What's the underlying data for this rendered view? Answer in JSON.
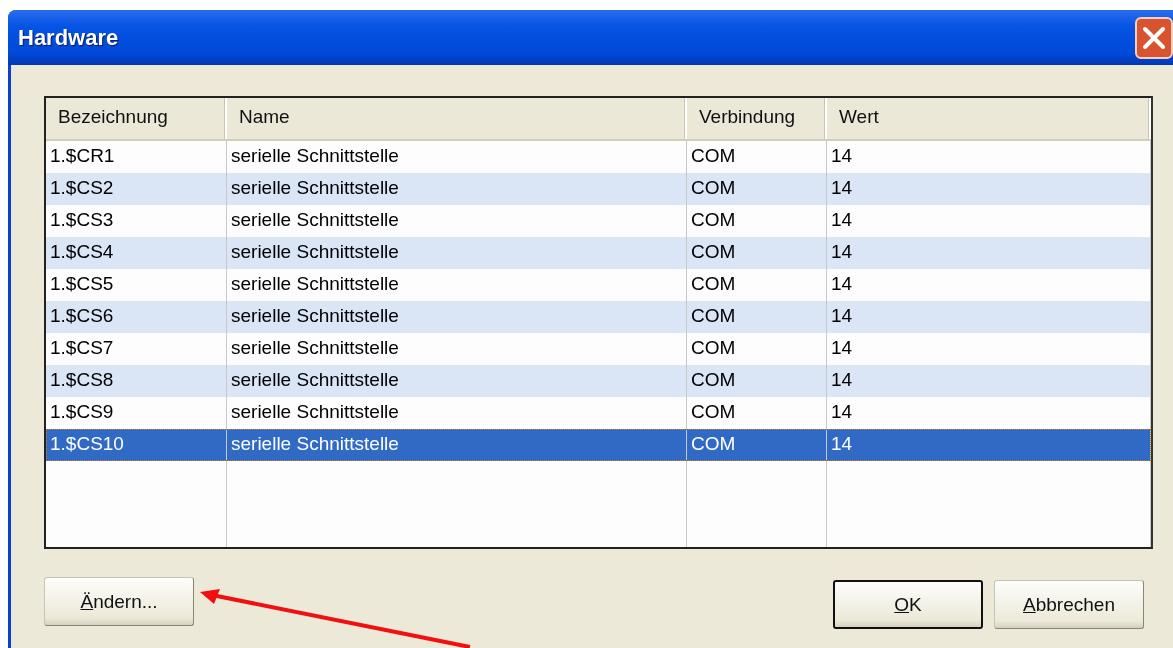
{
  "window": {
    "title": "Hardware"
  },
  "table": {
    "columns": [
      "Bezeichnung",
      "Name",
      "Verbindung",
      "Wert"
    ],
    "rows": [
      {
        "cells": [
          "1.$CR1",
          "serielle Schnittstelle",
          "COM",
          "14"
        ],
        "selected": false
      },
      {
        "cells": [
          "1.$CS2",
          "serielle Schnittstelle",
          "COM",
          "14"
        ],
        "selected": false
      },
      {
        "cells": [
          "1.$CS3",
          "serielle Schnittstelle",
          "COM",
          "14"
        ],
        "selected": false
      },
      {
        "cells": [
          "1.$CS4",
          "serielle Schnittstelle",
          "COM",
          "14"
        ],
        "selected": false
      },
      {
        "cells": [
          "1.$CS5",
          "serielle Schnittstelle",
          "COM",
          "14"
        ],
        "selected": false
      },
      {
        "cells": [
          "1.$CS6",
          "serielle Schnittstelle",
          "COM",
          "14"
        ],
        "selected": false
      },
      {
        "cells": [
          "1.$CS7",
          "serielle Schnittstelle",
          "COM",
          "14"
        ],
        "selected": false
      },
      {
        "cells": [
          "1.$CS8",
          "serielle Schnittstelle",
          "COM",
          "14"
        ],
        "selected": false
      },
      {
        "cells": [
          "1.$CS9",
          "serielle Schnittstelle",
          "COM",
          "14"
        ],
        "selected": false
      },
      {
        "cells": [
          "1.$CS10",
          "serielle Schnittstelle",
          "COM",
          "14"
        ],
        "selected": true
      }
    ]
  },
  "buttons": [
    {
      "label": "Ändern...",
      "kind": "left",
      "default": false,
      "access_key_underlined": true
    },
    {
      "label": "OK",
      "kind": "right",
      "default": true,
      "access_key_underlined": true
    },
    {
      "label": "Abbrechen",
      "kind": "right",
      "default": false,
      "access_key_underlined": true
    }
  ]
}
